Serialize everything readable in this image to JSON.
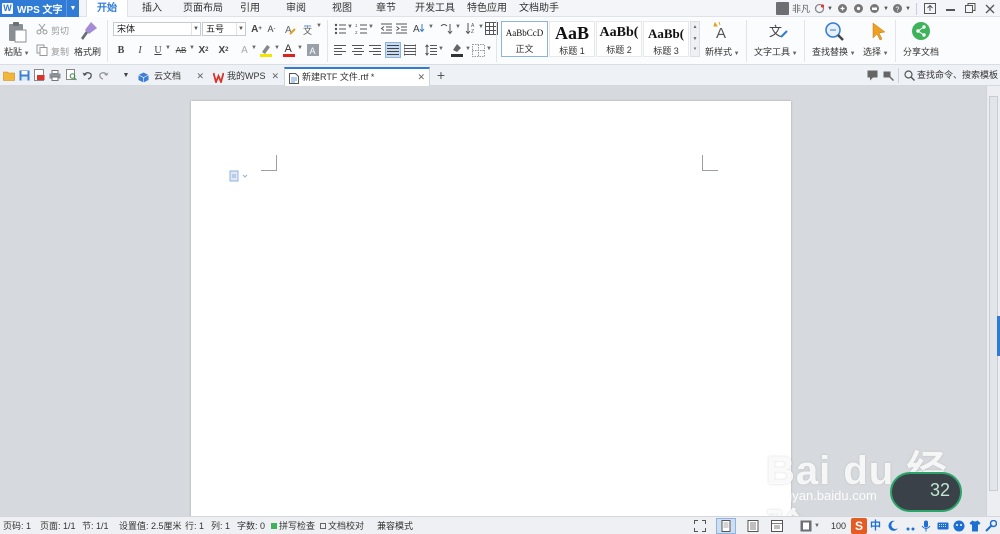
{
  "app": {
    "name": "WPS 文字",
    "logo_letter": "W"
  },
  "menu": {
    "tabs": [
      "开始",
      "插入",
      "页面布局",
      "引用",
      "审阅",
      "视图",
      "章节",
      "开发工具",
      "特色应用",
      "文档助手"
    ],
    "active_index": 0,
    "user_name": "非凡"
  },
  "ribbon": {
    "paste_label": "粘贴",
    "cut_label": "剪切",
    "copy_label": "复制",
    "format_painter_label": "格式刷",
    "font_name": "宋体",
    "font_size": "五号",
    "styles": [
      {
        "sample": "AaBbCcD",
        "name": "正文"
      },
      {
        "sample": "AaB",
        "name": "标题 1"
      },
      {
        "sample": "AaBb(",
        "name": "标题 2"
      },
      {
        "sample": "AaBb(",
        "name": "标题 3"
      }
    ],
    "new_style_label": "新样式",
    "text_tools_label": "文字工具",
    "find_replace_label": "查找替换",
    "select_label": "选择",
    "share_label": "分享文档"
  },
  "tabbar": {
    "tabs": [
      {
        "label": "云文档"
      },
      {
        "label": "我的WPS"
      },
      {
        "label": "新建RTF 文件.rtf *"
      }
    ],
    "active_index": 2,
    "search_label": "查找命令、搜索模板"
  },
  "status": {
    "page_num": "页码: 1",
    "page": "页面: 1/1",
    "section": "节: 1/1",
    "setting": "设置值: 2.5厘米",
    "row": "行: 1",
    "col": "列: 1",
    "word_count": "字数: 0",
    "spell_check": "拼写检查",
    "proofread": "文档校对",
    "compat_mode": "兼容模式",
    "zoom": "100"
  },
  "watermark": {
    "brand": "Bai du 经验",
    "url": "jingyan.baidu.com",
    "badge_value": "32"
  },
  "colors": {
    "accent": "#2f7bd6",
    "menubar_bg": "#f3f5f8",
    "ribbon_bg": "#fbfcfd",
    "doc_bg": "#d6d9dd",
    "share_green": "#3fb25c"
  }
}
